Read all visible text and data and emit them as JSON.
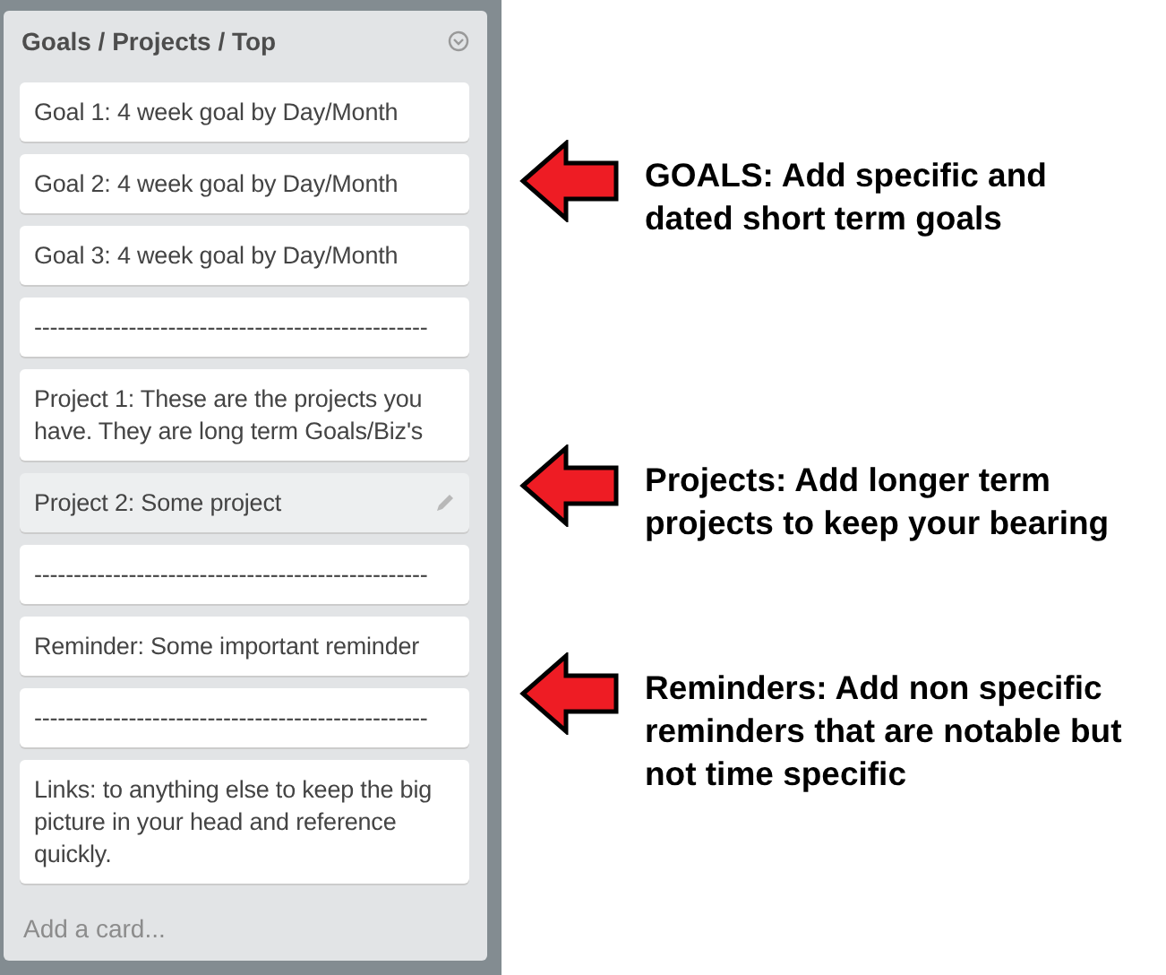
{
  "list": {
    "title": "Goals / Projects / Top",
    "cards": [
      {
        "text": "Goal 1: 4 week goal by Day/Month",
        "hovered": false
      },
      {
        "text": "Goal 2: 4 week goal by Day/Month",
        "hovered": false
      },
      {
        "text": "Goal 3: 4 week goal by Day/Month",
        "hovered": false
      },
      {
        "text": "--------------------------------------------------",
        "hovered": false
      },
      {
        "text": "Project 1: These are the projects you have. They are long term Goals/Biz's",
        "hovered": false
      },
      {
        "text": "Project 2: Some project",
        "hovered": true
      },
      {
        "text": "--------------------------------------------------",
        "hovered": false
      },
      {
        "text": "Reminder: Some important reminder",
        "hovered": false
      },
      {
        "text": "--------------------------------------------------",
        "hovered": false
      },
      {
        "text": "Links: to anything else to keep the big picture in your head and reference quickly.",
        "hovered": false
      }
    ],
    "add_card": "Add a card..."
  },
  "annotations": [
    {
      "text": "GOALS: Add specific and dated short term goals"
    },
    {
      "text": "Projects: Add longer term projects to keep your bearing"
    },
    {
      "text": "Reminders: Add non specific reminders that are notable but not time specific"
    }
  ]
}
